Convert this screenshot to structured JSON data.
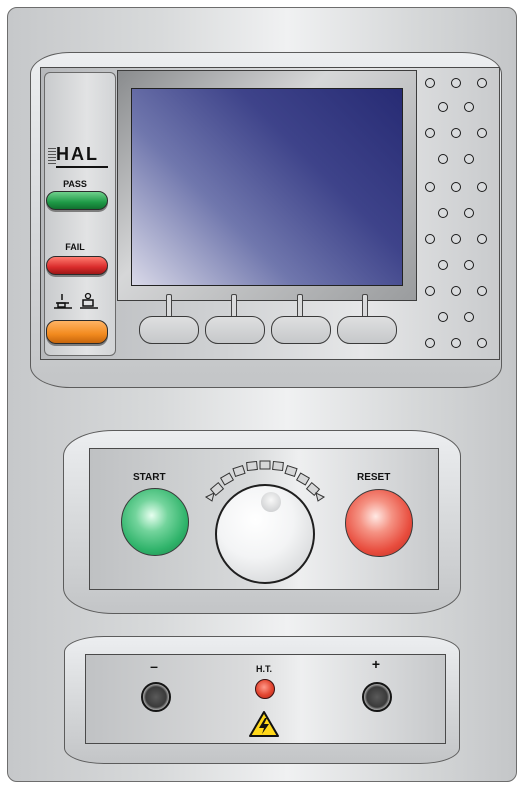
{
  "brand": {
    "logo_text": "HAL"
  },
  "indicators": {
    "pass_label": "PASS",
    "fail_label": "FAIL",
    "pass_color": "#1f9a47",
    "fail_color": "#d92b2b",
    "mode_color": "#f28a1e",
    "mode_icon": "test-mode-icon"
  },
  "softkeys": {
    "count": 4
  },
  "controls": {
    "start_label": "START",
    "reset_label": "RESET",
    "start_color": "#2fb36a",
    "reset_color": "#e84c3d",
    "knob_icon": "rotary-knob-icon"
  },
  "ht_panel": {
    "minus_label": "–",
    "ht_label": "H.T.",
    "plus_label": "+",
    "led_color": "#e2442f",
    "warning_icon": "high-voltage-warning-icon"
  }
}
